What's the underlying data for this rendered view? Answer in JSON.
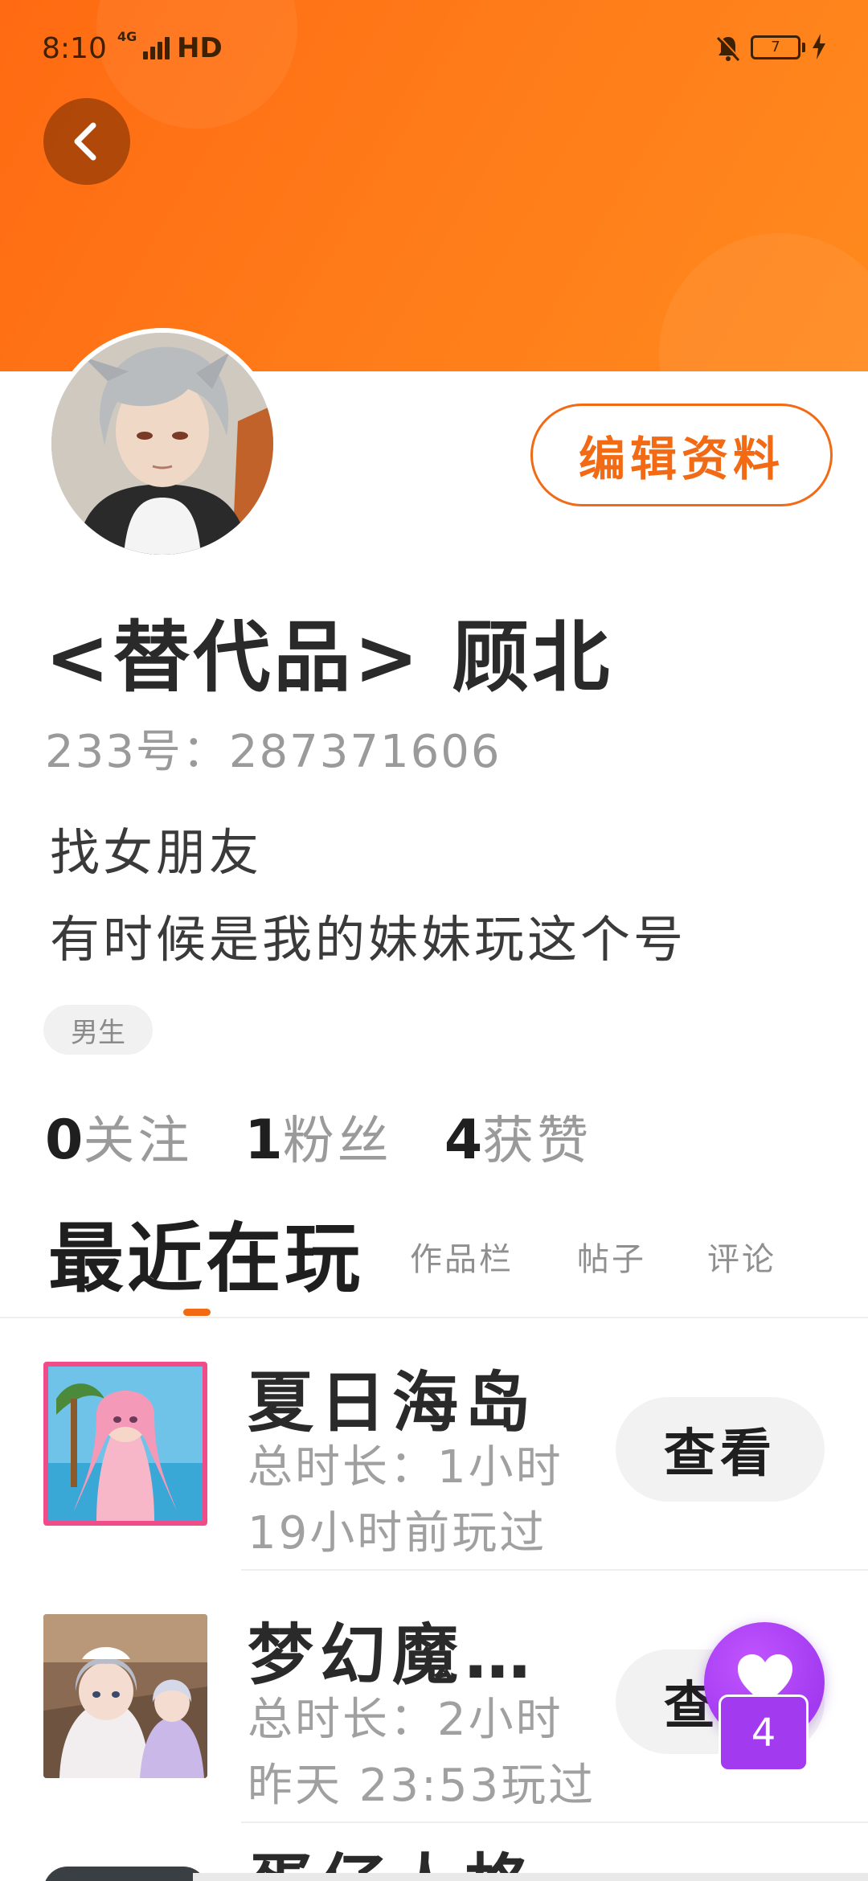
{
  "status_bar": {
    "time": "8:10",
    "network": "4G",
    "hd": "HD",
    "battery": "7"
  },
  "profile": {
    "username": "<替代品>  顾北",
    "uid": "233号：287371606",
    "bio": [
      "找女朋友",
      "有时候是我的妹妹玩这个号"
    ],
    "gender_tag": "男生",
    "edit_label": "编辑资料"
  },
  "stats": [
    {
      "count": "0",
      "label": "关注"
    },
    {
      "count": "1",
      "label": "粉丝"
    },
    {
      "count": "4",
      "label": "获赞"
    }
  ],
  "tabs": {
    "active": "最近在玩",
    "others": [
      "作品栏",
      "帖子",
      "评论"
    ]
  },
  "games": [
    {
      "name": "夏日海岛",
      "duration": "总时长：1小时",
      "last_played": "19小时前玩过",
      "button": "查看"
    },
    {
      "name": "梦幻魔…",
      "duration": "总时长：2小时",
      "last_played": "昨天 23:53玩过",
      "button": "查看"
    },
    {
      "name": "蛋仔人格",
      "duration": "",
      "last_played": "",
      "button": ""
    }
  ],
  "fab": {
    "badge": "4"
  },
  "colors": {
    "accent": "#f26a14",
    "header": "#ff7a18",
    "fab": "#a23af0"
  }
}
